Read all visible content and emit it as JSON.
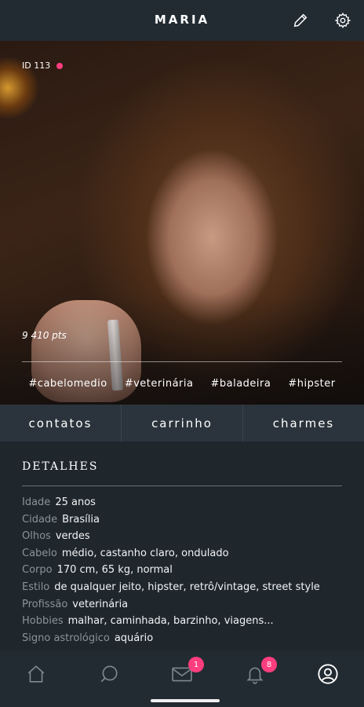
{
  "header": {
    "title": "MARIA"
  },
  "profile": {
    "id_label": "ID 113",
    "points": "9 410 pts",
    "tags": [
      "#cabelomedio",
      "#veterinária",
      "#baladeira",
      "#hipster"
    ]
  },
  "tabs": [
    {
      "label": "contatos"
    },
    {
      "label": "carrinho"
    },
    {
      "label": "charmes"
    }
  ],
  "details": {
    "heading": "DETALHES",
    "rows": [
      {
        "key": "Idade",
        "value": "25 anos"
      },
      {
        "key": "Cidade",
        "value": "Brasília"
      },
      {
        "key": "Olhos",
        "value": "verdes"
      },
      {
        "key": "Cabelo",
        "value": "médio, castanho claro, ondulado"
      },
      {
        "key": "Corpo",
        "value": "170 cm, 65 kg, normal"
      },
      {
        "key": "Estilo",
        "value": "de qualquer jeito, hipster, retrô/vintage, street style"
      },
      {
        "key": "Profissão",
        "value": "veterinária"
      },
      {
        "key": "Hobbies",
        "value": "malhar, caminhada, barzinho, viagens..."
      },
      {
        "key": "Signo astrológico",
        "value": "aquário"
      }
    ]
  },
  "nav": {
    "mail_badge": "1",
    "notifications_badge": "8"
  },
  "colors": {
    "accent": "#ff3d7f",
    "background": "#1f262c",
    "bar": "#232b32"
  }
}
